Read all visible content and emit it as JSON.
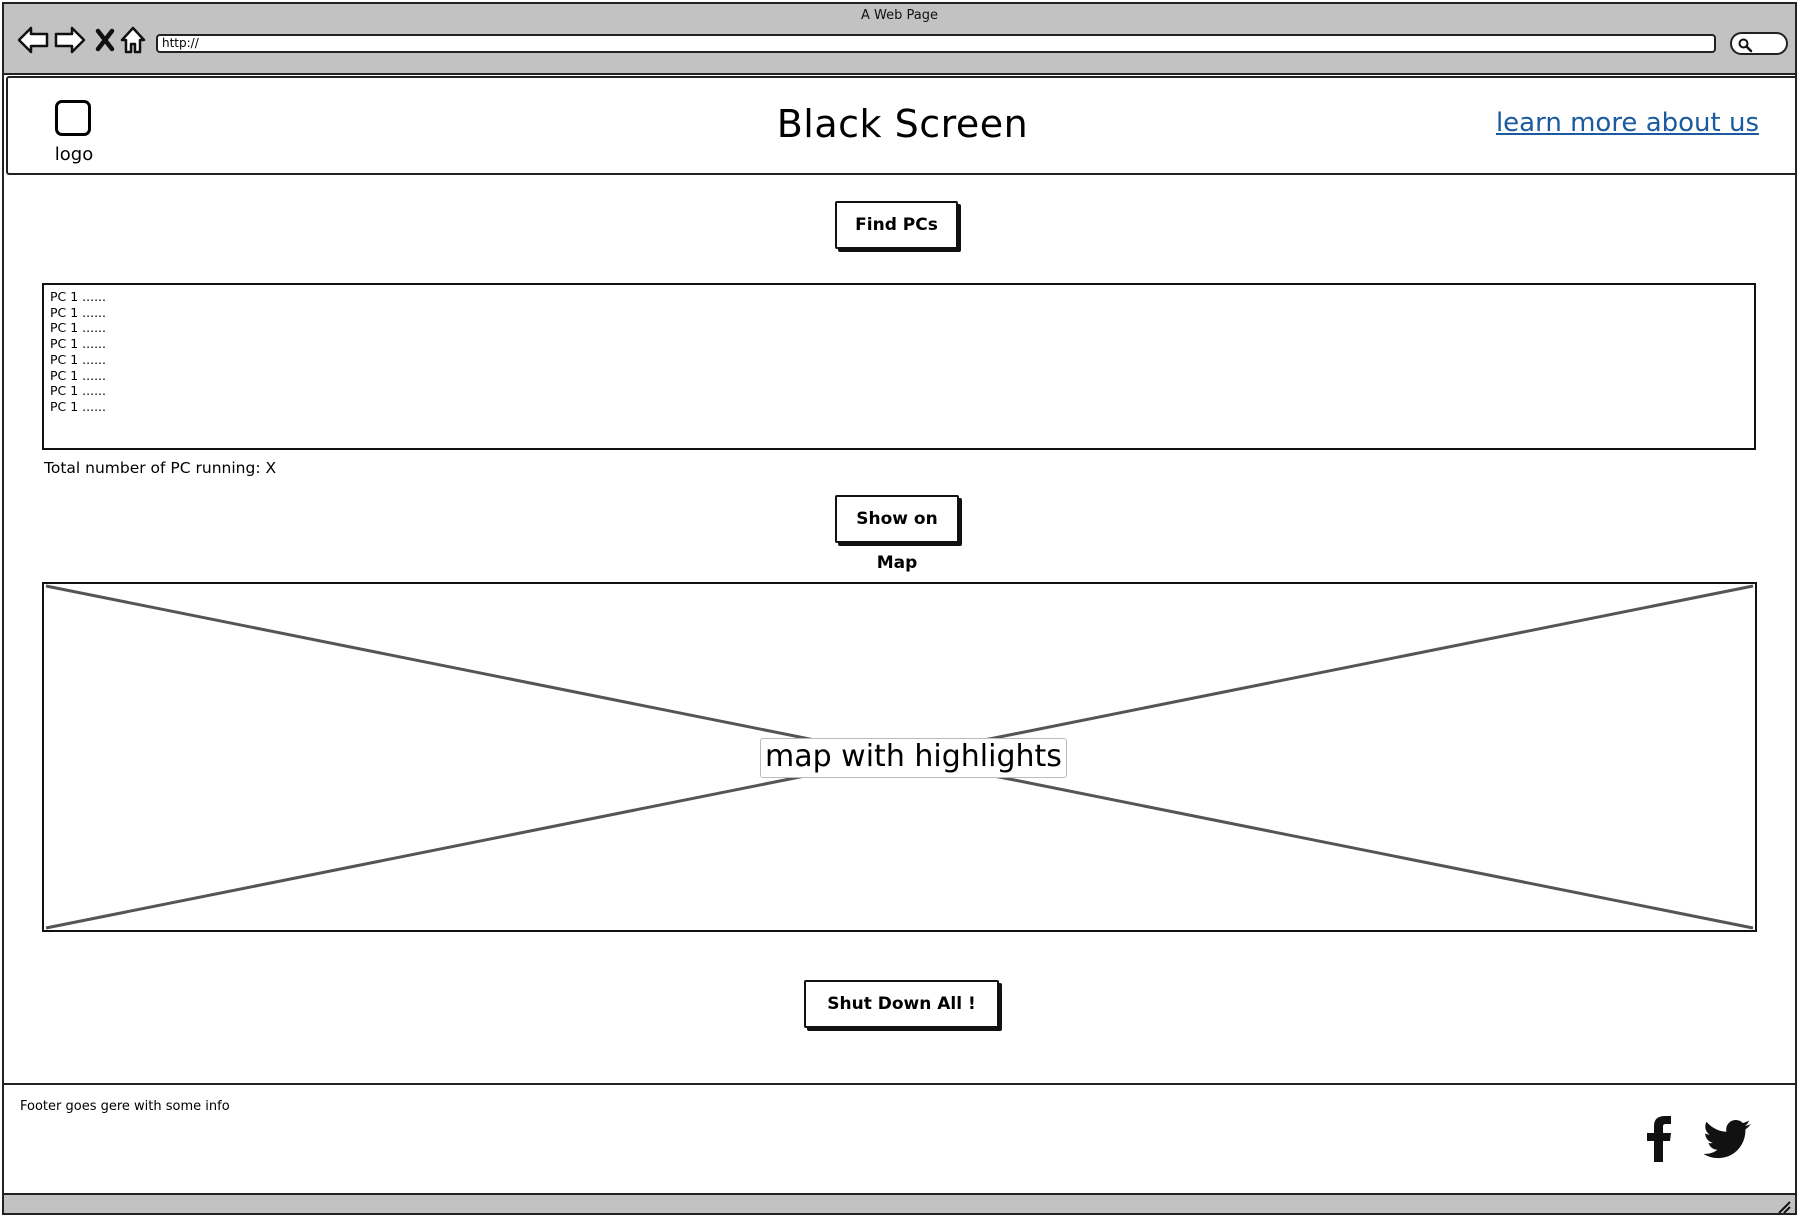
{
  "window": {
    "title": "A Web Page",
    "url": "http://"
  },
  "header": {
    "logo_label": "logo",
    "title": "Black Screen",
    "link": "learn more about us"
  },
  "main": {
    "find_button": "Find PCs",
    "pc_list": [
      "PC 1 ......",
      "PC 1 ......",
      "PC 1 ......",
      "PC 1 ......",
      "PC 1 ......",
      "PC 1 ......",
      "PC 1 ......",
      "PC 1 ......"
    ],
    "total_text": "Total number of PC running: X",
    "map_button": "Show on Map",
    "map_label": "map with highlights",
    "shutdown_button": "Shut Down All !"
  },
  "footer": {
    "text": "Footer goes gere with some info"
  },
  "icons": [
    "back-arrow-icon",
    "forward-arrow-icon",
    "stop-icon",
    "home-icon",
    "search-icon",
    "facebook-icon",
    "twitter-icon",
    "resize-grip-icon"
  ],
  "colors": {
    "chrome": "#c2c2c2",
    "link": "#1a5aa0"
  }
}
